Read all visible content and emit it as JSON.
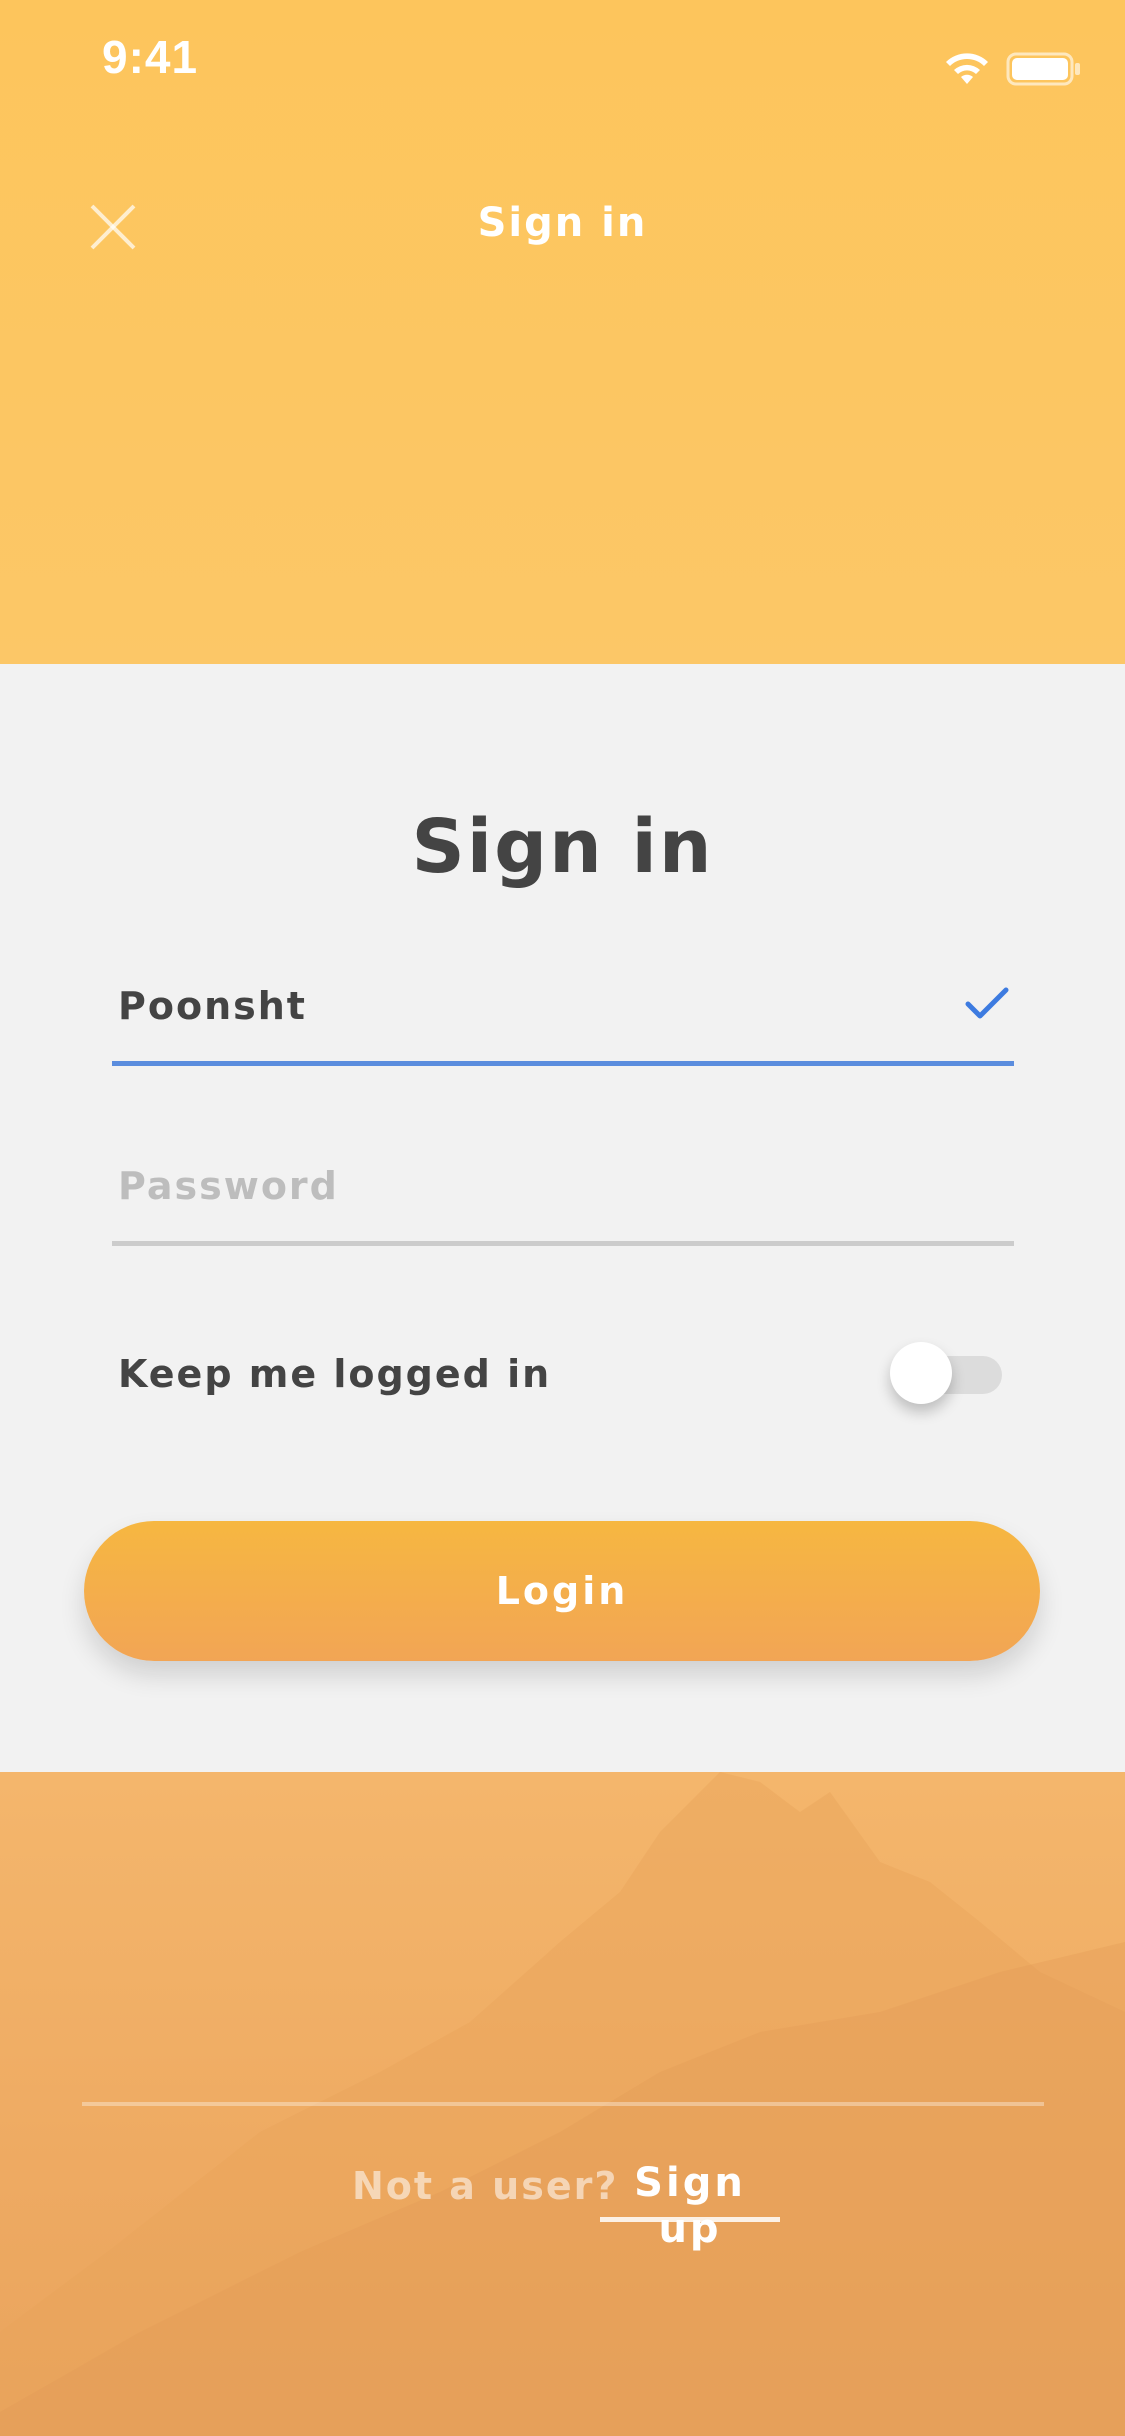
{
  "status_bar": {
    "time": "9:41",
    "icons": [
      "wifi-icon",
      "battery-icon"
    ]
  },
  "header": {
    "title": "Sign in",
    "close_icon": "close-icon"
  },
  "form": {
    "title": "Sign in",
    "username": {
      "value": "Poonsht",
      "valid_icon": "checkmark-icon"
    },
    "password": {
      "value": "",
      "placeholder": "Password"
    },
    "keep_logged_in": {
      "label": "Keep me logged in",
      "on": false
    },
    "login_label": "Login"
  },
  "footer": {
    "prompt": "Not a user?",
    "signup_label": "Sign up"
  },
  "colors": {
    "header_bg": "#fdc55c",
    "accent_blue": "#5b8dde",
    "button_gradient_top": "#f6b741",
    "button_gradient_bottom": "#f2a555",
    "card_bg": "#f2f2f2",
    "text_dark": "#444444"
  }
}
